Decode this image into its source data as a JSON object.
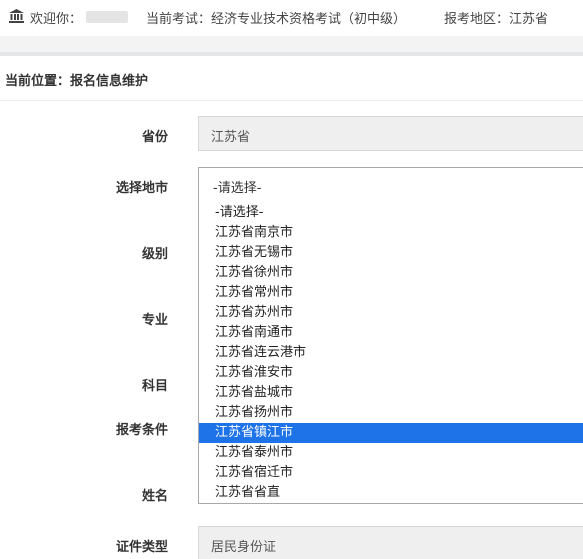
{
  "header": {
    "welcome": "欢迎你：",
    "exam": "当前考试：经济专业技术资格考试（初中级）",
    "region": "报考地区：江苏省"
  },
  "breadcrumb": "当前位置：报名信息维护",
  "form": {
    "province_label": "省份",
    "province_value": "江苏省",
    "city_label": "选择地市",
    "city_value": "-请选择-",
    "level_label": "级别",
    "major_label": "专业",
    "subject_label": "科目",
    "condition_label": "报考条件",
    "name_label": "姓名",
    "idtype_label": "证件类型",
    "idtype_value": "居民身份证"
  },
  "city_options": [
    "-请选择-",
    "江苏省南京市",
    "江苏省无锡市",
    "江苏省徐州市",
    "江苏省常州市",
    "江苏省苏州市",
    "江苏省南通市",
    "江苏省连云港市",
    "江苏省淮安市",
    "江苏省盐城市",
    "江苏省扬州市",
    "江苏省镇江市",
    "江苏省泰州市",
    "江苏省宿迁市",
    "江苏省省直"
  ],
  "highlighted_option": "江苏省镇江市",
  "colors": {
    "highlight": "#1e73e8",
    "readonly_field": "#efefef"
  },
  "icons": {
    "header": "bank-icon"
  }
}
